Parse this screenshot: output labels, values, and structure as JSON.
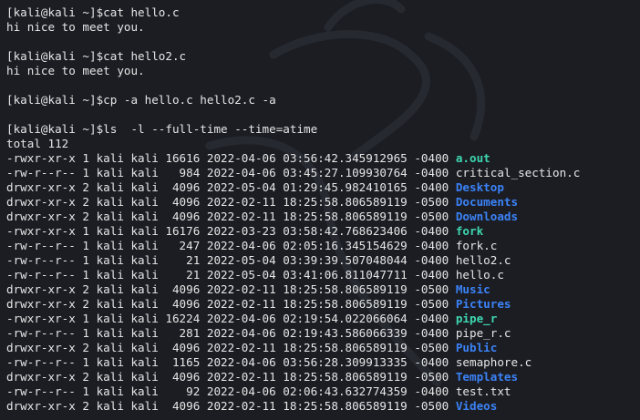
{
  "colors": {
    "background": "#1b1d23",
    "text": "#e6e6e6",
    "executable": "#3ed6b0",
    "directory": "#3b82f6"
  },
  "session": [
    {
      "type": "cmd",
      "text": "[kali@kali ~]$cat hello.c"
    },
    {
      "type": "out",
      "text": "hi nice to meet you."
    },
    {
      "type": "blank"
    },
    {
      "type": "cmd",
      "text": "[kali@kali ~]$cat hello2.c"
    },
    {
      "type": "out",
      "text": "hi nice to meet you."
    },
    {
      "type": "blank"
    },
    {
      "type": "cmd",
      "text": "[kali@kali ~]$cp -a hello.c hello2.c -a"
    },
    {
      "type": "blank"
    },
    {
      "type": "cmd",
      "text": "[kali@kali ~]$ls  -l --full-time --time=atime"
    },
    {
      "type": "out",
      "text": "total 112"
    }
  ],
  "listing": [
    {
      "meta": "-rwxr-xr-x 1 kali kali 16616 2022-04-06 03:56:42.345912965 -0400 ",
      "name": "a.out",
      "kind": "executable"
    },
    {
      "meta": "-rw-r--r-- 1 kali kali   984 2022-04-06 03:45:27.109930764 -0400 ",
      "name": "critical_section.c",
      "kind": "file"
    },
    {
      "meta": "drwxr-xr-x 2 kali kali  4096 2022-05-04 01:29:45.982410165 -0400 ",
      "name": "Desktop",
      "kind": "directory"
    },
    {
      "meta": "drwxr-xr-x 2 kali kali  4096 2022-02-11 18:25:58.806589119 -0500 ",
      "name": "Documents",
      "kind": "directory"
    },
    {
      "meta": "drwxr-xr-x 2 kali kali  4096 2022-02-11 18:25:58.806589119 -0500 ",
      "name": "Downloads",
      "kind": "directory"
    },
    {
      "meta": "-rwxr-xr-x 1 kali kali 16176 2022-03-23 03:58:42.768623406 -0400 ",
      "name": "fork",
      "kind": "executable"
    },
    {
      "meta": "-rw-r--r-- 1 kali kali   247 2022-04-06 02:05:16.345154629 -0400 ",
      "name": "fork.c",
      "kind": "file"
    },
    {
      "meta": "-rw-r--r-- 1 kali kali    21 2022-05-04 03:39:39.507048044 -0400 ",
      "name": "hello2.c",
      "kind": "file"
    },
    {
      "meta": "-rw-r--r-- 1 kali kali    21 2022-05-04 03:41:06.811047711 -0400 ",
      "name": "hello.c",
      "kind": "file"
    },
    {
      "meta": "drwxr-xr-x 2 kali kali  4096 2022-02-11 18:25:58.806589119 -0500 ",
      "name": "Music",
      "kind": "directory"
    },
    {
      "meta": "drwxr-xr-x 2 kali kali  4096 2022-02-11 18:25:58.806589119 -0500 ",
      "name": "Pictures",
      "kind": "directory"
    },
    {
      "meta": "-rwxr-xr-x 1 kali kali 16224 2022-04-06 02:19:54.022066064 -0400 ",
      "name": "pipe_r",
      "kind": "executable"
    },
    {
      "meta": "-rw-r--r-- 1 kali kali   281 2022-04-06 02:19:43.586066339 -0400 ",
      "name": "pipe_r.c",
      "kind": "file"
    },
    {
      "meta": "drwxr-xr-x 2 kali kali  4096 2022-02-11 18:25:58.806589119 -0500 ",
      "name": "Public",
      "kind": "directory"
    },
    {
      "meta": "-rw-r--r-- 1 kali kali  1165 2022-04-06 03:56:28.309913335 -0400 ",
      "name": "semaphore.c",
      "kind": "file"
    },
    {
      "meta": "drwxr-xr-x 2 kali kali  4096 2022-02-11 18:25:58.806589119 -0500 ",
      "name": "Templates",
      "kind": "directory"
    },
    {
      "meta": "-rw-r--r-- 1 kali kali    92 2022-04-06 02:06:43.632774359 -0400 ",
      "name": "test.txt",
      "kind": "file"
    },
    {
      "meta": "drwxr-xr-x 2 kali kali  4096 2022-02-11 18:25:58.806589119 -0500 ",
      "name": "Videos",
      "kind": "directory"
    }
  ]
}
